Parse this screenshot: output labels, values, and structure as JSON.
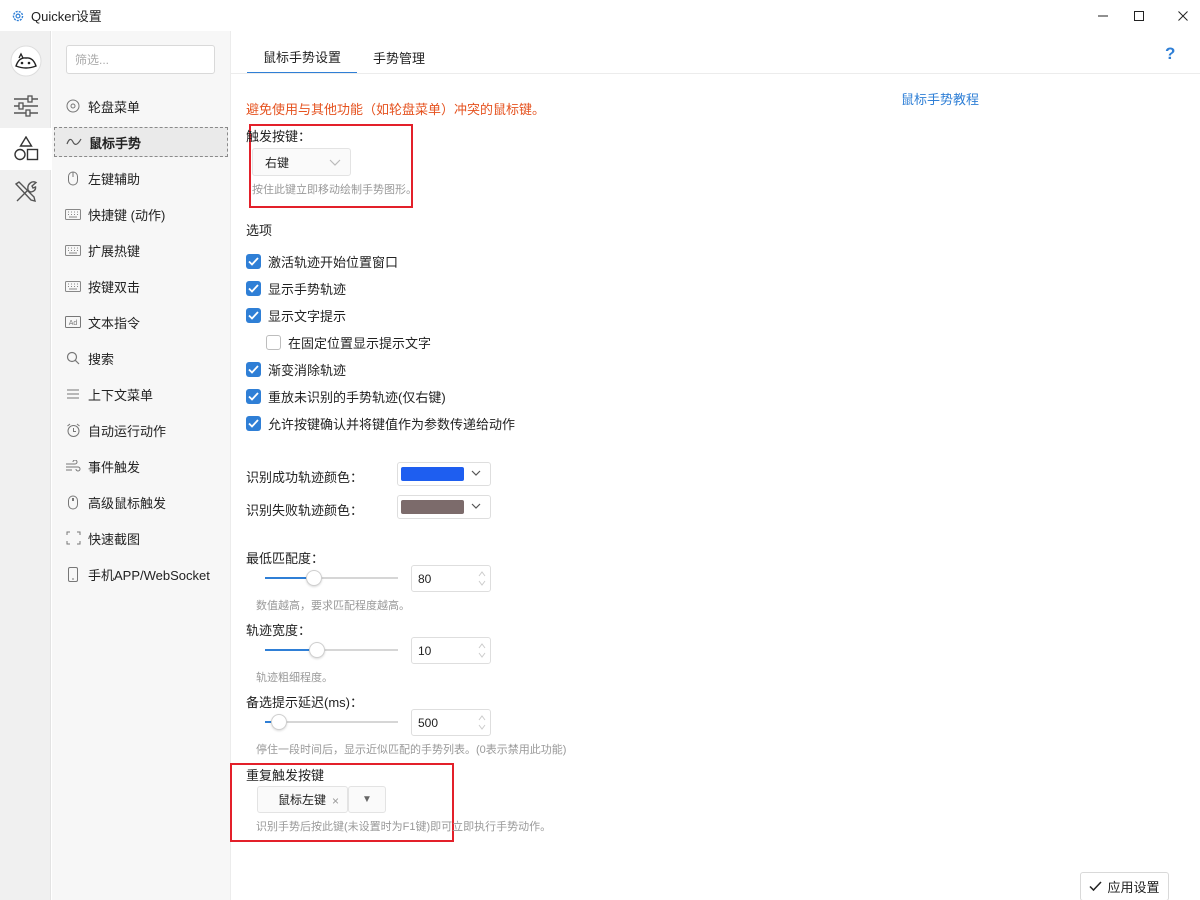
{
  "window": {
    "title": "Quicker设置"
  },
  "nav": {
    "search_placeholder": "筛选...",
    "items": [
      {
        "label": "轮盘菜单",
        "icon": "wheel-icon"
      },
      {
        "label": "鼠标手势",
        "icon": "gesture-icon"
      },
      {
        "label": "左键辅助",
        "icon": "mouse-icon"
      },
      {
        "label": "快捷键 (动作)",
        "icon": "keyboard-icon"
      },
      {
        "label": "扩展热键",
        "icon": "keyboard-icon"
      },
      {
        "label": "按键双击",
        "icon": "keyboard-icon"
      },
      {
        "label": "文本指令",
        "icon": "ad-icon"
      },
      {
        "label": "搜索",
        "icon": "search-icon"
      },
      {
        "label": "上下文菜单",
        "icon": "menu-icon"
      },
      {
        "label": "自动运行动作",
        "icon": "alarm-icon"
      },
      {
        "label": "事件触发",
        "icon": "wind-icon"
      },
      {
        "label": "高级鼠标触发",
        "icon": "mouse-icon"
      },
      {
        "label": "快速截图",
        "icon": "crop-icon"
      },
      {
        "label": "手机APP/WebSocket",
        "icon": "phone-icon"
      }
    ]
  },
  "tabs": [
    {
      "label": "鼠标手势设置"
    },
    {
      "label": "手势管理"
    }
  ],
  "help_label": "?",
  "warning": "避免使用与其他功能（如轮盘菜单）冲突的鼠标键。",
  "tutorial_link": "鼠标手势教程",
  "trigger": {
    "label": "触发按键：",
    "value": "右键",
    "hint": "按住此键立即移动绘制手势图形。"
  },
  "options": {
    "heading": "选项",
    "items": [
      {
        "label": "激活轨迹开始位置窗口",
        "checked": true
      },
      {
        "label": "显示手势轨迹",
        "checked": true
      },
      {
        "label": "显示文字提示",
        "checked": true
      },
      {
        "label": "在固定位置显示提示文字",
        "checked": false
      },
      {
        "label": "渐变消除轨迹",
        "checked": true
      },
      {
        "label": "重放未识别的手势轨迹(仅右键)",
        "checked": true
      },
      {
        "label": "允许按键确认并将键值作为参数传递给动作",
        "checked": true
      }
    ]
  },
  "colors": {
    "success_label": "识别成功轨迹颜色：",
    "success_color": "#1e5ef0",
    "fail_label": "识别失败轨迹颜色：",
    "fail_color": "#7c6b6b"
  },
  "match": {
    "label": "最低匹配度：",
    "value": "80",
    "fraction": 0.35,
    "hint": "数值越高，要求匹配程度越高。"
  },
  "width": {
    "label": "轨迹宽度：",
    "value": "10",
    "fraction": 0.38,
    "hint": "轨迹粗细程度。"
  },
  "delay": {
    "label": "备选提示延迟(ms)：",
    "value": "500",
    "fraction": 0.05,
    "hint": "停住一段时间后，显示近似匹配的手势列表。(0表示禁用此功能)"
  },
  "repeat": {
    "label": "重复触发按键",
    "tag": "鼠标左键",
    "remove_label": "×",
    "dropdown_label": "▼",
    "hint": "识别手势后按此键(未设置时为F1键)即可立即执行手势动作。"
  },
  "apply_button": "应用设置"
}
